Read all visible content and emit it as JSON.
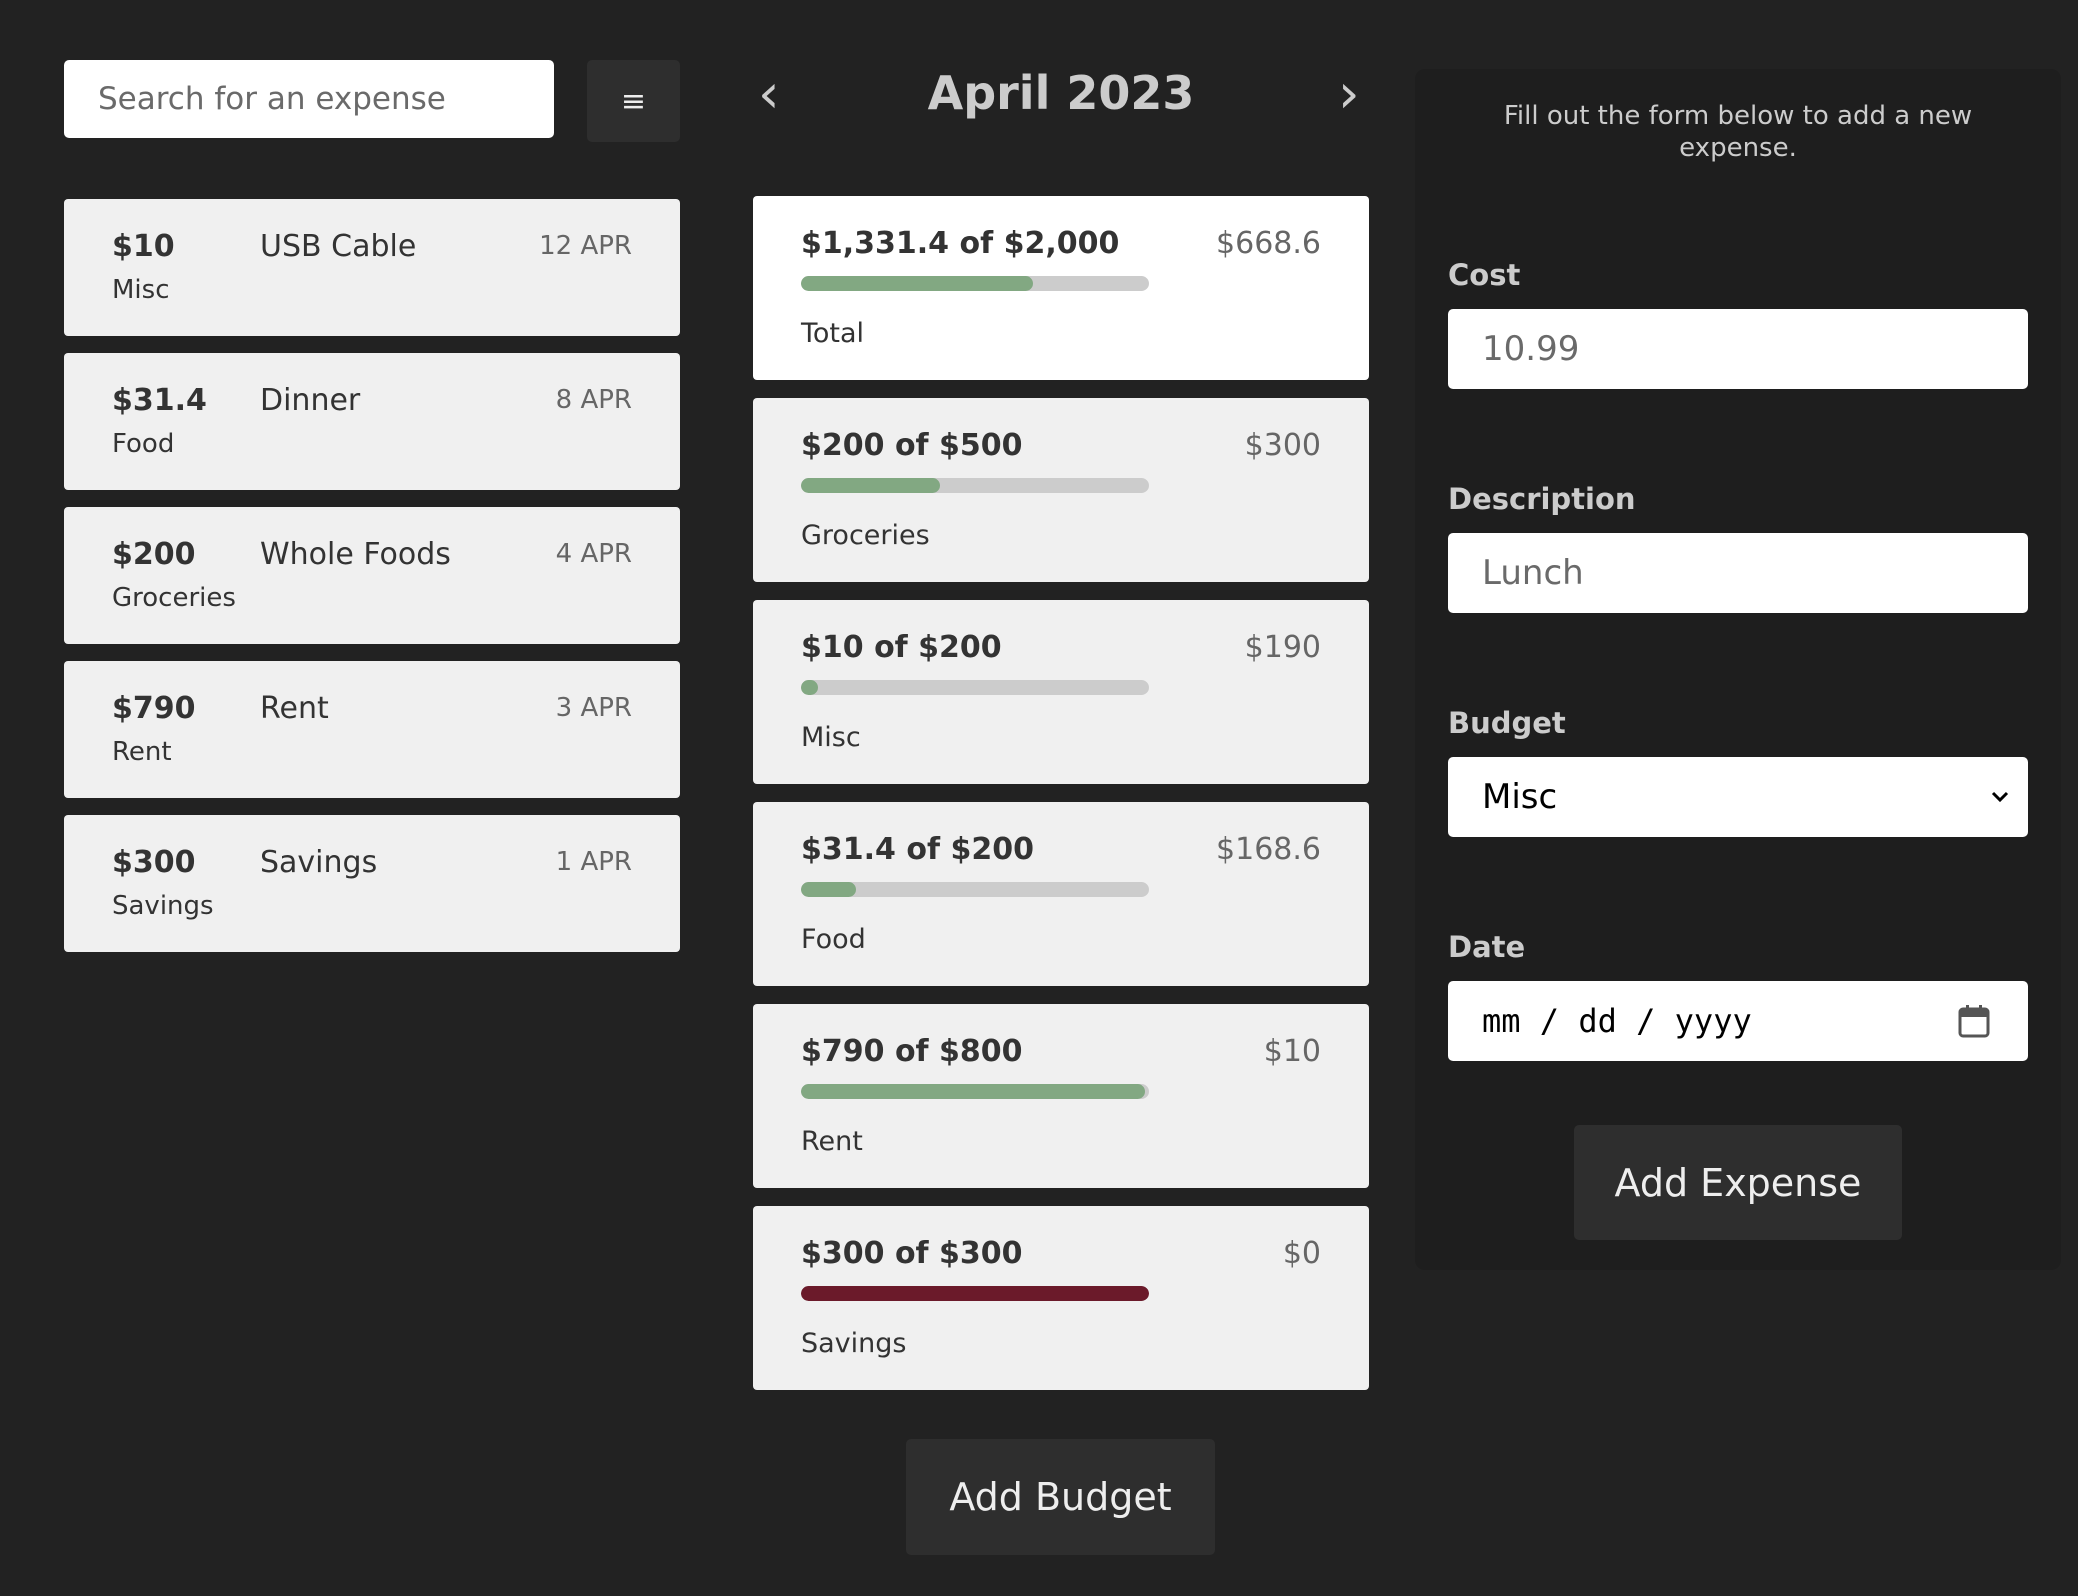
{
  "search": {
    "placeholder": "Search for an expense"
  },
  "menu": {
    "icon": "hamburger-icon",
    "glyph": "≡"
  },
  "expenses": [
    {
      "amount": "$10",
      "category": "Misc",
      "description": "USB Cable",
      "date": "12 APR"
    },
    {
      "amount": "$31.4",
      "category": "Food",
      "description": "Dinner",
      "date": "8 APR"
    },
    {
      "amount": "$200",
      "category": "Groceries",
      "description": "Whole Foods",
      "date": "4 APR"
    },
    {
      "amount": "$790",
      "category": "Rent",
      "description": "Rent",
      "date": "3 APR"
    },
    {
      "amount": "$300",
      "category": "Savings",
      "description": "Savings",
      "date": "1 APR"
    }
  ],
  "month": {
    "title": "April 2023",
    "prev_glyph": "‹",
    "next_glyph": "›"
  },
  "budgets": [
    {
      "header": "$1,331.4 of $2,000",
      "remaining": "$668.6",
      "name": "Total",
      "progress": 0.6657
    },
    {
      "header": "$200 of $500",
      "remaining": "$300",
      "name": "Groceries",
      "progress": 0.4
    },
    {
      "header": "$10 of $200",
      "remaining": "$190",
      "name": "Misc",
      "progress": 0.05
    },
    {
      "header": "$31.4 of $200",
      "remaining": "$168.6",
      "name": "Food",
      "progress": 0.157
    },
    {
      "header": "$790 of $800",
      "remaining": "$10",
      "name": "Rent",
      "progress": 0.9875
    },
    {
      "header": "$300 of $300",
      "remaining": "$0",
      "name": "Savings",
      "progress": 1.0
    }
  ],
  "colors": {
    "progress": "#82a882",
    "progress_full": "#6b1a2a",
    "track": "#cccccc",
    "background": "#222222"
  },
  "add_budget_label": "Add Budget",
  "form": {
    "intro": "Fill out the form below to add a new expense.",
    "cost_label": "Cost",
    "cost_placeholder": "10.99",
    "description_label": "Description",
    "description_placeholder": "Lunch",
    "budget_label": "Budget",
    "budget_value": "Misc",
    "date_label": "Date",
    "date_placeholder": "mm / dd / yyyy",
    "submit_label": "Add Expense"
  }
}
